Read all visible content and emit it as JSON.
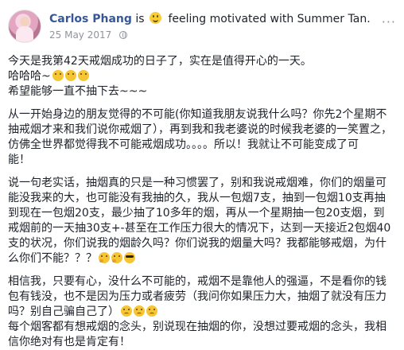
{
  "post": {
    "author": "Carlos Phang",
    "feeling_prefix": "is",
    "feeling_text": "feeling motivated with Summer Tan.",
    "date": "25 May 2017",
    "more_label": "···",
    "lines": [
      "今天是我第42天戒烟成功的日子了，实在是值得开心的一天。",
      "哈哈哈~",
      "希望能够一直不抽下去~~~",
      "从一开始身边的朋友觉得的不可能(你知道我朋友说我什么吗？你先2个星期不",
      "抽戒烟才来和我们说你戒烟了），再到我和我老婆说的时候我老婆的一笑置之，",
      "仿佛全世界都觉得我不可能戒烟成功。。。。所以！我就让不可能变成了可",
      "能！",
      "说一句老实话，抽烟真的只是一种习惯罢了，别和我说戒烟难，你们的烟量可",
      "能没我来的大，也可能没有我抽的久，我从一包烟7支，抽到一包烟10支再抽",
      "到现在一包烟20支，最少抽了10多年的烟，再从一个星期抽一包20支烟，到",
      "戒烟前的一天抽30支+-甚至在工作压力很大的情况下，达到一天接近2包烟40",
      "支的状况，你们说我的烟龄久吗？你们说我的烟量大吗？我都能够戒烟，为什",
      "么你们不能？？？",
      "相信我，只要有心，没什么不可能的，戒烟不是靠他人的强逼，不是看你的钱",
      "包有钱没，也不是因为压力或者疲劳（我问你如果压力大，抽烟了就没有压力",
      "吗？别自己骗自己了）",
      "每个烟客都有想戒烟的念头，别说现在抽烟的你，没想过要戒烟的念头，我相",
      "信你绝对有也是肯定有！"
    ]
  }
}
